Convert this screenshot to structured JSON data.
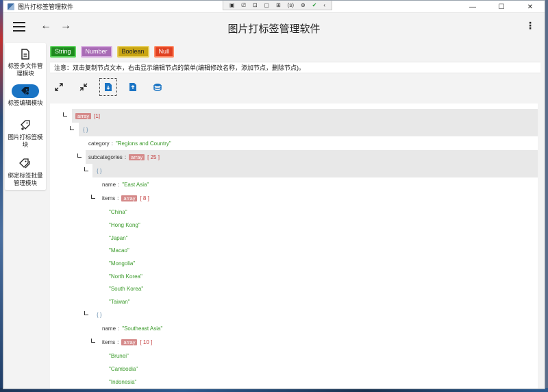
{
  "window": {
    "title": "图片打标签管理软件",
    "minimize": "—",
    "maximize": "☐",
    "close": "✕"
  },
  "debug_toolbar": {
    "items": [
      "▣",
      "⎚",
      "⊡",
      "▢",
      "⊞",
      "(s)",
      "⊛"
    ],
    "collapse": "‹"
  },
  "appbar": {
    "title": "图片打标签管理软件",
    "back": "←",
    "forward": "→",
    "more": "⋮"
  },
  "sidebar": {
    "items": [
      {
        "label": "标签多文件管理模块",
        "icon": "document-icon"
      },
      {
        "label": "标签编辑模块",
        "icon": "tag-edit-icon"
      },
      {
        "label": "图片打标签模块",
        "icon": "tag-add-icon"
      },
      {
        "label": "绑定标签批量管理模块",
        "icon": "tags-icon"
      }
    ]
  },
  "type_chips": {
    "string": "String",
    "number": "Number",
    "boolean": "Boolean",
    "null": "Null"
  },
  "notice": "注意：双击复制节点文本，右击显示编辑节点的菜单(编辑修改名称，添加节点，删除节点)。",
  "tools": [
    "expand-all-icon",
    "collapse-all-icon",
    "file-import-icon",
    "file-export-icon",
    "database-icon"
  ],
  "tree": {
    "root_type": "array",
    "root_count": "[1]",
    "obj_open": "{ }",
    "category_key": "category",
    "category_value": "\"Regions and Country\"",
    "subcategories_key": "subcategories",
    "subcategories_type": "array",
    "subcategories_count": "[ 25 ]",
    "name_key": "name",
    "items_key": "items",
    "groups": [
      {
        "name": "\"East Asia\"",
        "items_type": "array",
        "items_count": "[ 8 ]",
        "items": [
          "\"China\"",
          "\"Hong Kong\"",
          "\"Japan\"",
          "\"Macao\"",
          "\"Mongolia\"",
          "\"North Korea\"",
          "\"South Korea\"",
          "\"Taiwan\""
        ]
      },
      {
        "name": "\"Southeast Asia\"",
        "items_type": "array",
        "items_count": "[ 10 ]",
        "items": [
          "\"Brunei\"",
          "\"Cambodia\"",
          "\"Indonesia\""
        ]
      }
    ]
  },
  "colors": {
    "accent": "#1a74c4",
    "string": "#1f8a1f",
    "number": "#a86bb5",
    "boolean": "#c9a512",
    "null": "#e04020"
  }
}
